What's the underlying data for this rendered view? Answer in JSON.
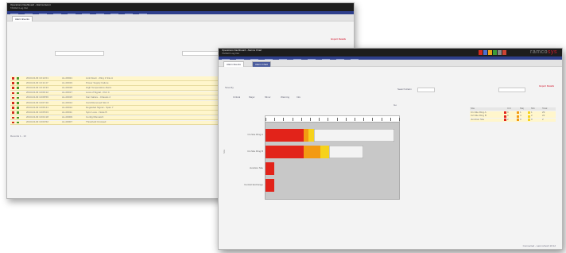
{
  "brand": {
    "left": "ramco",
    "right": "sys"
  },
  "back_window": {
    "title": "Operations Dashboard - Alarms Event",
    "subtitle": "TANGO Log Out",
    "tab": "Alarm Events",
    "link_right": "Export Details",
    "rows": [
      {
        "time": "2013-04-03 10:12:01",
        "code": "AL-00021",
        "desc": "Link Down - Ring 1 Site A"
      },
      {
        "time": "2013-04-03 10:11:47",
        "code": "AL-00019",
        "desc": "Power Supply Failure"
      },
      {
        "time": "2013-04-03 10:10:33",
        "code": "AL-00018",
        "desc": "High Temperature Alarm"
      },
      {
        "time": "2013-04-03 10:09:12",
        "code": "AL-00017",
        "desc": "Loss of Signal - Port 4"
      },
      {
        "time": "2013-04-03 10:08:56",
        "code": "AL-00015",
        "desc": "Fan Failure - Chassis 2"
      },
      {
        "time": "2013-04-03 10:07:20",
        "code": "AL-00014",
        "desc": "Card Removed Slot 3"
      },
      {
        "time": "2013-04-03 10:06:41",
        "code": "AL-00012",
        "desc": "Degraded Signal - Span 7"
      },
      {
        "time": "2013-04-03 10:05:03",
        "code": "AL-00011",
        "desc": "Sync Loss - Node B"
      },
      {
        "time": "2013-04-03 10:04:18",
        "code": "AL-00009",
        "desc": "Config Mismatch"
      },
      {
        "time": "2013-04-03 10:03:52",
        "code": "AL-00007",
        "desc": "Threshold Crossed"
      }
    ],
    "pager": "Records 1 - 10"
  },
  "front_window": {
    "title": "Operations Dashboard - Alarms Chart",
    "subtitle": "TANGO Log Out",
    "tabs": [
      "Alarm Events",
      "Alarm Chart"
    ],
    "link_right": "Export Details",
    "filter_label": "Severity",
    "toggles": [
      "Critical",
      "Major",
      "Minor",
      "Warning",
      "Info"
    ],
    "search_label": "Search Alarm",
    "button": "Go",
    "status": "Connected - Last refresh 10:12"
  },
  "chart_data": {
    "type": "bar",
    "orientation": "horizontal",
    "stacked": true,
    "title": "Alarm Count",
    "ylabel": "Site",
    "categories": [
      "C1-Site Ring A",
      "C2-Site Ring B",
      "Junction Site",
      "Central Exchange"
    ],
    "xlim": [
      0,
      30
    ],
    "series": [
      {
        "name": "Critical",
        "color": "#e2231a",
        "values": [
          8.5,
          8.5,
          2.0,
          2.0
        ]
      },
      {
        "name": "Major",
        "color": "#f39a12",
        "values": [
          1.2,
          3.8,
          0,
          0
        ]
      },
      {
        "name": "Minor",
        "color": "#f6d21c",
        "values": [
          1.2,
          2.0,
          0,
          0
        ]
      },
      {
        "name": "Cleared",
        "color": "#f3f3f3",
        "values": [
          18.1,
          7.7,
          0,
          0
        ]
      }
    ]
  },
  "mini_table": {
    "headers": [
      "Site",
      "Crit",
      "Maj",
      "Min",
      "Total"
    ],
    "rows": [
      {
        "site": "C1-Site Ring A",
        "crit": "9",
        "maj": "1",
        "min": "1",
        "total": "29"
      },
      {
        "site": "C2-Site Ring B",
        "crit": "9",
        "maj": "4",
        "min": "2",
        "total": "22"
      },
      {
        "site": "Junction Site",
        "crit": "2",
        "maj": "0",
        "min": "0",
        "total": "2"
      }
    ]
  }
}
